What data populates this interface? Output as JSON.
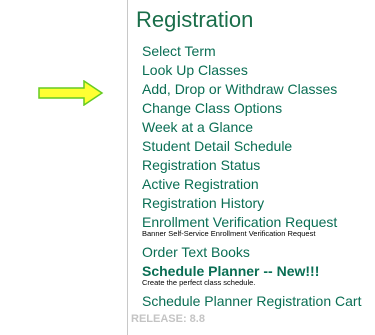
{
  "colors": {
    "title": "#1a6e4a",
    "link": "#0a6e54",
    "arrow_fill": "#ffff33",
    "arrow_stroke": "#66cc22",
    "release": "#c4c4c4"
  },
  "arrow": {
    "icon": "right-arrow-icon"
  },
  "panel": {
    "title": "Registration",
    "items": [
      {
        "label": "Select Term"
      },
      {
        "label": "Look Up Classes"
      },
      {
        "label": "Add, Drop or Withdraw Classes"
      },
      {
        "label": "Change Class Options"
      },
      {
        "label": "Week at a Glance"
      },
      {
        "label": "Student Detail Schedule"
      },
      {
        "label": "Registration Status"
      },
      {
        "label": "Active Registration"
      },
      {
        "label": "Registration History"
      },
      {
        "label": "Enrollment Verification Request",
        "description": "Banner Self-Service Enrollment Verification Request"
      },
      {
        "label": "Order Text Books"
      },
      {
        "label": "Schedule Planner -- New!!!",
        "description": "Create the perfect class schedule."
      },
      {
        "label": "Schedule Planner Registration Cart"
      }
    ],
    "release": "RELEASE: 8.8"
  }
}
